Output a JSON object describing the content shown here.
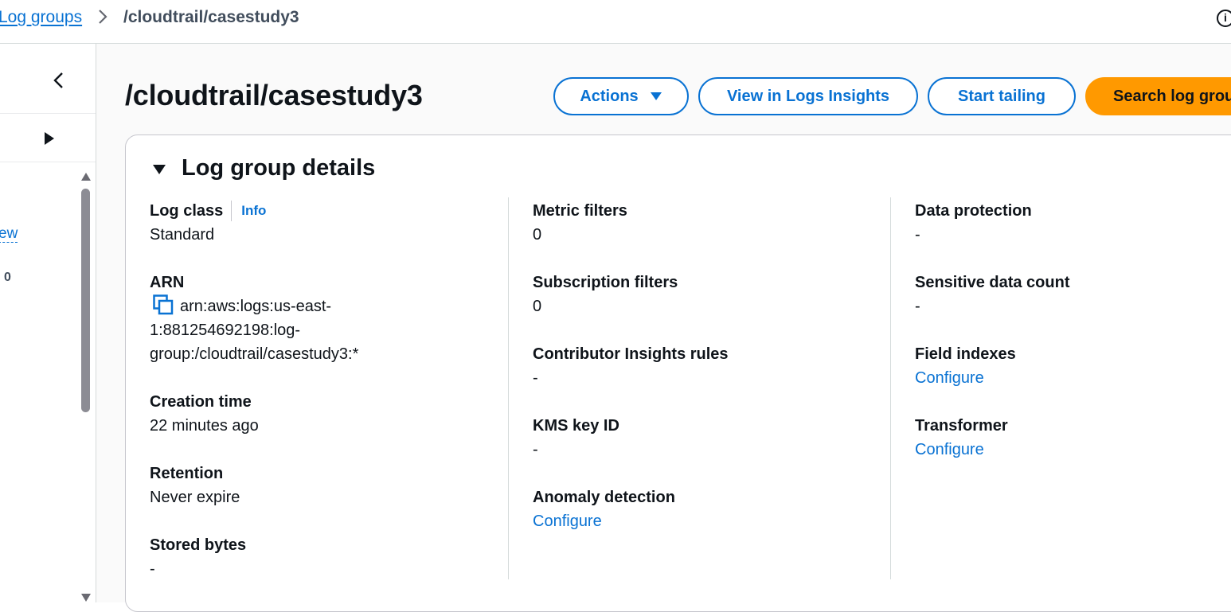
{
  "breadcrumb": {
    "parent": "Log groups",
    "current": "/cloudtrail/casestudy3"
  },
  "header_info_icon": "i",
  "side_panel": {
    "link_text": "ew",
    "count": "0"
  },
  "page": {
    "title": "/cloudtrail/casestudy3"
  },
  "buttons": {
    "actions": "Actions",
    "view_insights": "View in Logs Insights",
    "start_tailing": "Start tailing",
    "search": "Search log grou"
  },
  "details": {
    "title": "Log group details",
    "info_label": "Info",
    "col1": {
      "log_class_label": "Log class",
      "log_class_value": "Standard",
      "arn_label": "ARN",
      "arn_value": "arn:aws:logs:us-east-1:881254692198:log-group:/cloudtrail/casestudy3:*",
      "creation_label": "Creation time",
      "creation_value": "22 minutes ago",
      "retention_label": "Retention",
      "retention_value": "Never expire",
      "stored_label": "Stored bytes",
      "stored_value": "-"
    },
    "col2": {
      "metric_label": "Metric filters",
      "metric_value": "0",
      "subscription_label": "Subscription filters",
      "subscription_value": "0",
      "contributor_label": "Contributor Insights rules",
      "contributor_value": "-",
      "kms_label": "KMS key ID",
      "kms_value": "-",
      "anomaly_label": "Anomaly detection",
      "anomaly_link": "Configure"
    },
    "col3": {
      "protection_label": "Data protection",
      "protection_value": "-",
      "sensitive_label": "Sensitive data count",
      "sensitive_value": "-",
      "field_indexes_label": "Field indexes",
      "field_indexes_link": "Configure",
      "transformer_label": "Transformer",
      "transformer_link": "Configure"
    }
  },
  "colors": {
    "link": "#0972d3",
    "primary_button": "#ff9900",
    "text": "#0f141a",
    "border": "#c6c6cd"
  },
  "icons": [
    "chevron-right-icon",
    "info-circle-icon",
    "chevron-left-icon",
    "caret-right-icon",
    "caret-down-icon",
    "copy-icon",
    "scroll-up-arrow-icon",
    "scroll-down-arrow-icon"
  ]
}
